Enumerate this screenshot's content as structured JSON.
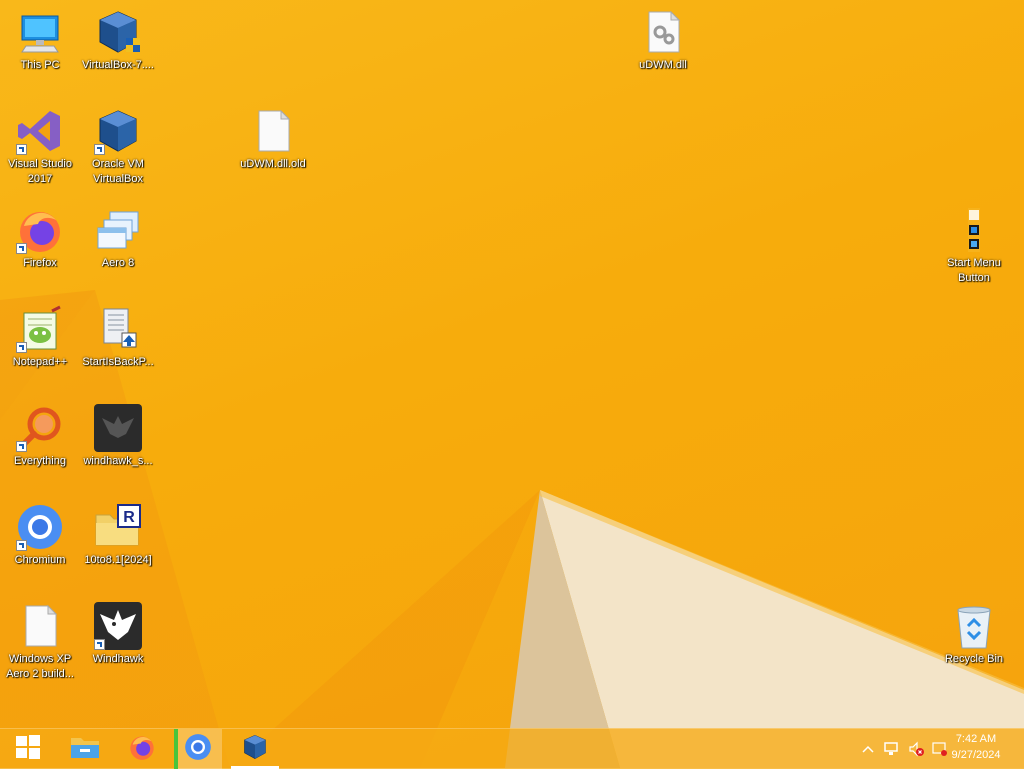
{
  "desktop": {
    "icons": [
      {
        "id": "this-pc",
        "label": "This PC"
      },
      {
        "id": "virtualbox-7",
        "label": "VirtualBox-7...."
      },
      {
        "id": "udwm-dll",
        "label": "uDWM.dll"
      },
      {
        "id": "visual-studio",
        "label": "Visual Studio 2017"
      },
      {
        "id": "oracle-vm",
        "label": "Oracle VM VirtualBox"
      },
      {
        "id": "udwm-dll-old",
        "label": "uDWM.dll.old"
      },
      {
        "id": "firefox",
        "label": "Firefox"
      },
      {
        "id": "aero8",
        "label": "Aero 8"
      },
      {
        "id": "start-menu-button",
        "label": "Start Menu Button"
      },
      {
        "id": "notepadpp",
        "label": "Notepad++"
      },
      {
        "id": "startisback",
        "label": "StartIsBackP..."
      },
      {
        "id": "everything",
        "label": "Everything"
      },
      {
        "id": "windhawk-s",
        "label": "windhawk_s..."
      },
      {
        "id": "chromium",
        "label": "Chromium"
      },
      {
        "id": "10to81",
        "label": "10to8.1[2024]"
      },
      {
        "id": "winxp-aero",
        "label": "Windows XP Aero 2 build..."
      },
      {
        "id": "windhawk",
        "label": "Windhawk"
      },
      {
        "id": "recycle-bin",
        "label": "Recycle Bin"
      }
    ]
  },
  "taskbar": {
    "clock_time": "7:42 AM",
    "clock_date": "9/27/2024"
  },
  "colors": {
    "wallpaper": "#f7ac0c",
    "taskbar": "#f6aa14"
  }
}
